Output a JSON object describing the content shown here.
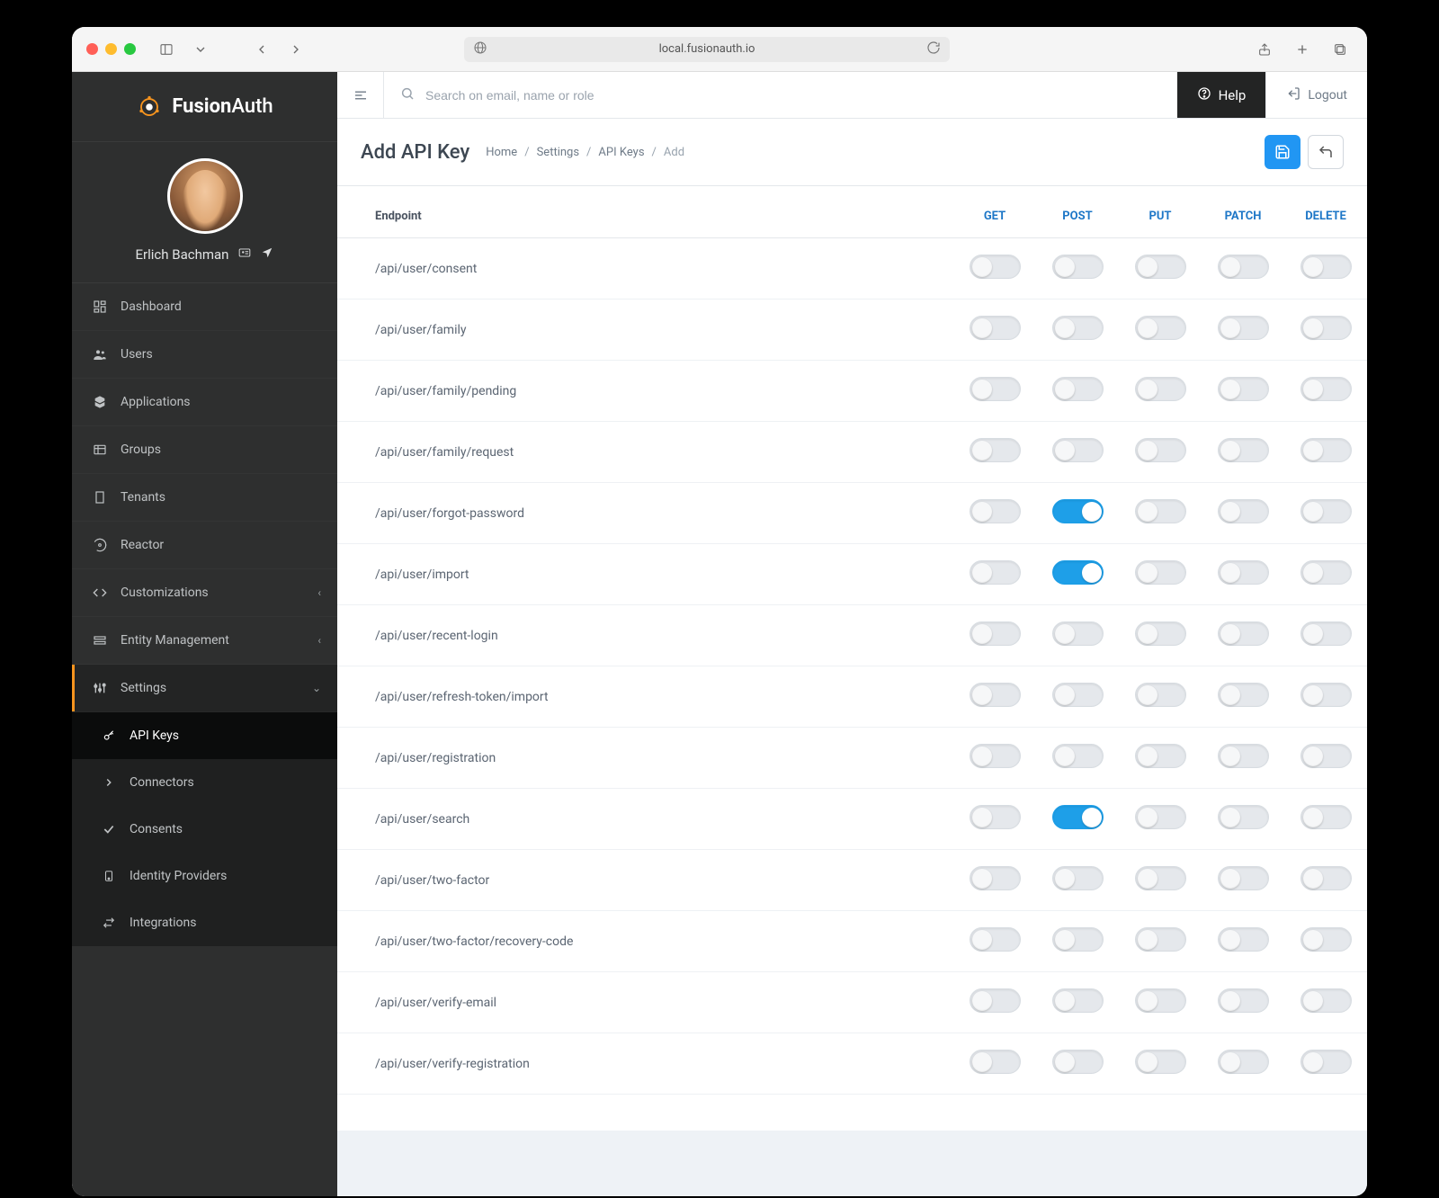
{
  "browser": {
    "url": "local.fusionauth.io"
  },
  "brand": {
    "name_prefix": "Fusion",
    "name_suffix": "Auth"
  },
  "profile": {
    "name": "Erlich Bachman"
  },
  "sidebar": {
    "items": [
      {
        "icon": "dashboard",
        "label": "Dashboard"
      },
      {
        "icon": "users",
        "label": "Users"
      },
      {
        "icon": "apps",
        "label": "Applications"
      },
      {
        "icon": "groups",
        "label": "Groups"
      },
      {
        "icon": "tenants",
        "label": "Tenants"
      },
      {
        "icon": "reactor",
        "label": "Reactor"
      },
      {
        "icon": "code",
        "label": "Customizations",
        "caret": true
      },
      {
        "icon": "entity",
        "label": "Entity Management",
        "caret": true
      },
      {
        "icon": "settings",
        "label": "Settings",
        "caret": true,
        "expanded": true
      }
    ],
    "subitems": [
      {
        "icon": "key",
        "label": "API Keys",
        "active": true
      },
      {
        "icon": "chevron",
        "label": "Connectors"
      },
      {
        "icon": "check",
        "label": "Consents"
      },
      {
        "icon": "idp",
        "label": "Identity Providers"
      },
      {
        "icon": "swap",
        "label": "Integrations"
      }
    ]
  },
  "topbar": {
    "search_placeholder": "Search on email, name or role",
    "help_label": "Help",
    "logout_label": "Logout"
  },
  "page": {
    "title": "Add API Key",
    "breadcrumbs": [
      "Home",
      "Settings",
      "API Keys",
      "Add"
    ]
  },
  "table": {
    "endpoint_header": "Endpoint",
    "methods": [
      "GET",
      "POST",
      "PUT",
      "PATCH",
      "DELETE"
    ],
    "rows": [
      {
        "endpoint": "/api/user/consent",
        "on": []
      },
      {
        "endpoint": "/api/user/family",
        "on": []
      },
      {
        "endpoint": "/api/user/family/pending",
        "on": []
      },
      {
        "endpoint": "/api/user/family/request",
        "on": []
      },
      {
        "endpoint": "/api/user/forgot-password",
        "on": [
          "POST"
        ]
      },
      {
        "endpoint": "/api/user/import",
        "on": [
          "POST"
        ]
      },
      {
        "endpoint": "/api/user/recent-login",
        "on": []
      },
      {
        "endpoint": "/api/user/refresh-token/import",
        "on": []
      },
      {
        "endpoint": "/api/user/registration",
        "on": []
      },
      {
        "endpoint": "/api/user/search",
        "on": [
          "POST"
        ]
      },
      {
        "endpoint": "/api/user/two-factor",
        "on": []
      },
      {
        "endpoint": "/api/user/two-factor/recovery-code",
        "on": []
      },
      {
        "endpoint": "/api/user/verify-email",
        "on": []
      },
      {
        "endpoint": "/api/user/verify-registration",
        "on": []
      }
    ]
  }
}
